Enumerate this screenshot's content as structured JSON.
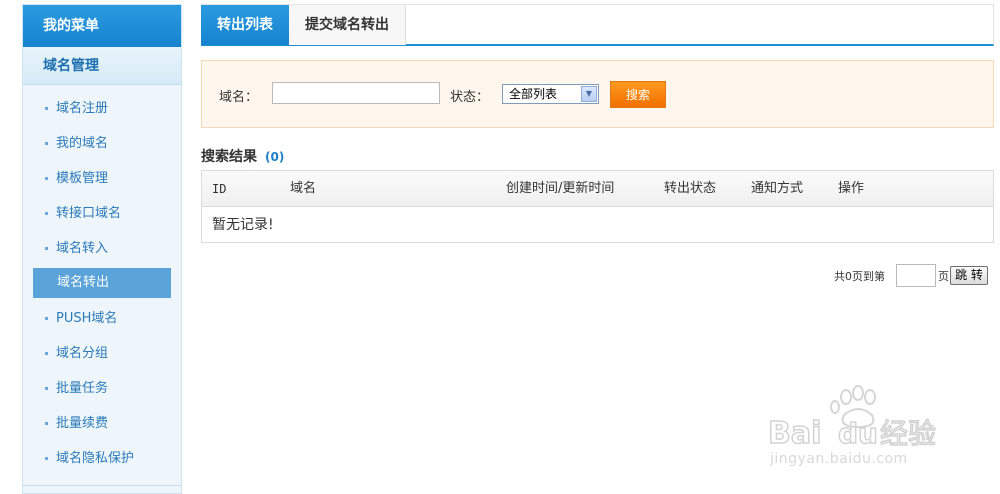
{
  "sidebar": {
    "title": "我的菜单",
    "section": "域名管理",
    "items": [
      {
        "label": "域名注册"
      },
      {
        "label": "我的域名"
      },
      {
        "label": "模板管理"
      },
      {
        "label": "转接口域名"
      },
      {
        "label": "域名转入"
      },
      {
        "label": "域名转出"
      },
      {
        "label": "PUSH域名"
      },
      {
        "label": "域名分组"
      },
      {
        "label": "批量任务"
      },
      {
        "label": "批量续费"
      },
      {
        "label": "域名隐私保护"
      }
    ]
  },
  "tabs": [
    {
      "label": "转出列表"
    },
    {
      "label": "提交域名转出"
    }
  ],
  "search": {
    "domain_label": "域名：",
    "domain_value": "",
    "status_label": "状态：",
    "status_value": "全部列表",
    "button": "搜索"
  },
  "results": {
    "title": "搜索结果",
    "count": "(0)",
    "columns": [
      "ID",
      "域名",
      "创建时间/更新时间",
      "转出状态",
      "通知方式",
      "操作"
    ],
    "empty": "暂无记录!"
  },
  "pagination": {
    "prefix": "共0页到第",
    "suffix": "页",
    "button": "跳 转"
  },
  "watermark": {
    "logo": "Bai du 经验",
    "url": "jingyan.baidu.com"
  },
  "colors": {
    "primary": "#1f8fd8",
    "accent": "#f07000",
    "active_item": "#5aa3d8"
  }
}
